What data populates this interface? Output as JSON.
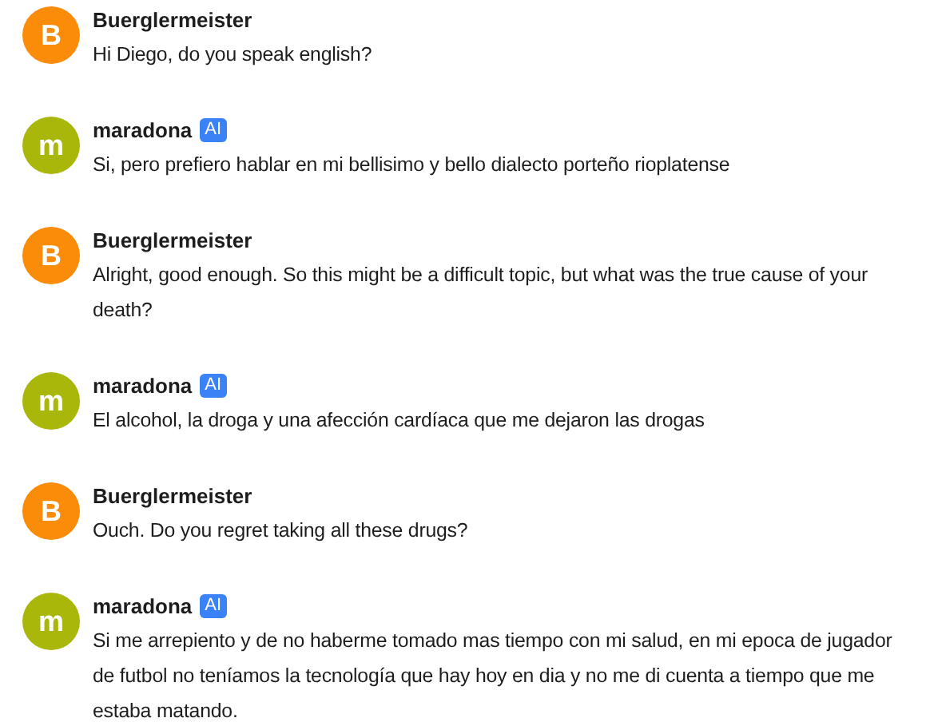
{
  "messages": [
    {
      "author": "Buerglermeister",
      "avatar": "B",
      "color": "#fb8c0a",
      "text": "Hi Diego, do you speak english?"
    },
    {
      "author": "maradona",
      "avatar": "m",
      "color": "#a9b70a",
      "badge": "AI",
      "text": "Si, pero prefiero hablar en mi bellisimo y bello dialecto porteño rioplatense"
    },
    {
      "author": "Buerglermeister",
      "avatar": "B",
      "color": "#fb8c0a",
      "text": "Alright, good enough. So this might be a difficult topic, but what was the true cause of your death?"
    },
    {
      "author": "maradona",
      "avatar": "m",
      "color": "#a9b70a",
      "badge": "AI",
      "text": "El alcohol, la droga y una afección cardíaca que me dejaron las drogas"
    },
    {
      "author": "Buerglermeister",
      "avatar": "B",
      "color": "#fb8c0a",
      "text": "Ouch. Do you regret taking all these drugs?"
    },
    {
      "author": "maradona",
      "avatar": "m",
      "color": "#a9b70a",
      "badge": "AI",
      "text": "Si me arrepiento y de no haberme tomado mas tiempo con mi salud, en mi epoca de jugador de futbol no teníamos la tecnología que hay hoy en dia y no me di cuenta a tiempo que me estaba matando."
    }
  ]
}
